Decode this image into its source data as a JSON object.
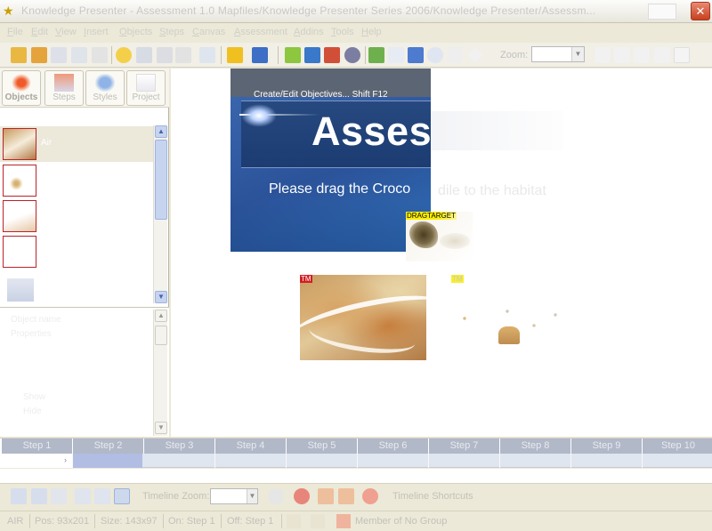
{
  "window": {
    "title": "Knowledge Presenter - Assessment 1.0 Mapfiles/Knowledge Presenter Series 2006/Knowledge Presenter/Assessm...",
    "close_label": "✕"
  },
  "menu": [
    "File",
    "Edit",
    "View",
    "Insert",
    "Objects",
    "Steps",
    "Canvas",
    "Assessment",
    "Addins",
    "Tools",
    "Help"
  ],
  "toolbar": {
    "zoom_label": "Zoom:",
    "zoom_value": ""
  },
  "side_tabs": [
    {
      "label": "Objects",
      "icon": "objects-icon",
      "active": true
    },
    {
      "label": "Steps",
      "icon": "steps-icon",
      "active": false
    },
    {
      "label": "Styles",
      "icon": "styles-icon",
      "active": false
    },
    {
      "label": "Project",
      "icon": "project-icon",
      "active": false
    }
  ],
  "objects": [
    {
      "label": "Air"
    },
    {
      "label": ""
    },
    {
      "label": ""
    },
    {
      "label": ""
    }
  ],
  "properties_ghost": [
    "Object name",
    "Properties",
    "Show",
    "Hide"
  ],
  "slide": {
    "strip_text": "Create/Edit Objectives...     Shift F12",
    "heading": "Asses",
    "instructions": "Please drag the Croco",
    "instructions_ghost": "dile to the habitat"
  },
  "canvas_objects": {
    "dragtarget_label": "DRAGTARGET",
    "tm1_label": "TM",
    "tm2_label": "TM"
  },
  "steps": [
    "Step 1",
    "Step 2",
    "Step 3",
    "Step 4",
    "Step 5",
    "Step 6",
    "Step 7",
    "Step 8",
    "Step 9",
    "Step 10"
  ],
  "current_step": 2,
  "timeline": {
    "zoom_label": "Timeline Zoom:",
    "zoom_value": "",
    "shortcuts_label": "Timeline Shortcuts"
  },
  "status": {
    "object": "AIR",
    "pos": "Pos: 93x201",
    "size": "Size: 143x97",
    "on": "On: Step 1",
    "off": "Off: Step 1",
    "group": "Member of No Group"
  },
  "colors": {
    "accent": "#b8242a",
    "slide_blue": "#2b539a",
    "step_head": "#b1b8c8",
    "step_current": "#b1bde3"
  }
}
